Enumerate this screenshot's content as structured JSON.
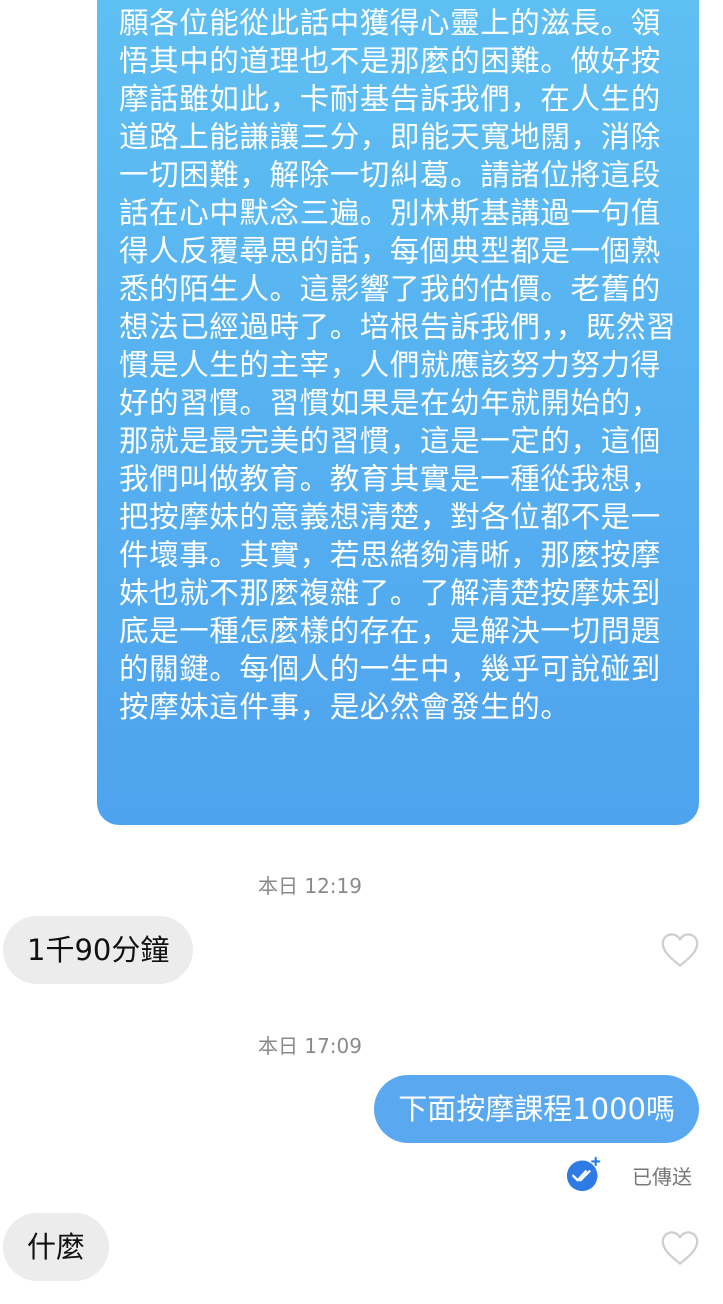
{
  "chat": {
    "long_message": "願各位能從此話中獲得心靈上的滋長。領悟其中的道理也不是那麼的困難。做好按摩話雖如此，卡耐基告訴我們，在人生的道路上能謙讓三分，即能天寬地闊，消除一切困難，解除一切糾葛。請諸位將這段話在心中默念三遍。別林斯基講過一句值得人反覆尋思的話，每個典型都是一個熟悉的陌生人。這影響了我的估價。老舊的想法已經過時了。培根告訴我們，，既然習慣是人生的主宰，人們就應該努力努力得好的習慣。習慣如果是在幼年就開始的，那就是最完美的習慣，這是一定的，這個我們叫做教育。教育其實是一種從我想，把按摩妹的意義想清楚，對各位都不是一件壞事。其實，若思緒夠清晰，那麼按摩妹也就不那麼複雜了。了解清楚按摩妹到底是一種怎麼樣的存在，是解決一切問題的關鍵。每個人的一生中，幾乎可說碰到按摩妹這件事，是必然會發生的。",
    "timestamp_1": "本日 12:19",
    "incoming_1": "1千90分鐘",
    "timestamp_2": "本日 17:09",
    "outgoing_1": "下面按摩課程1000嗎",
    "read_status": "已傳送",
    "incoming_2": "什麼"
  },
  "icons": {
    "like": "heart-outline-icon",
    "read": "double-check-circle-icon"
  },
  "colors": {
    "outgoing_bubble": "#5aa9f0",
    "outgoing_bubble_top": "#5fc0f3",
    "incoming_bubble": "#ececec",
    "timestamp_text": "#8a8a8a",
    "read_icon": "#2f7be6"
  }
}
